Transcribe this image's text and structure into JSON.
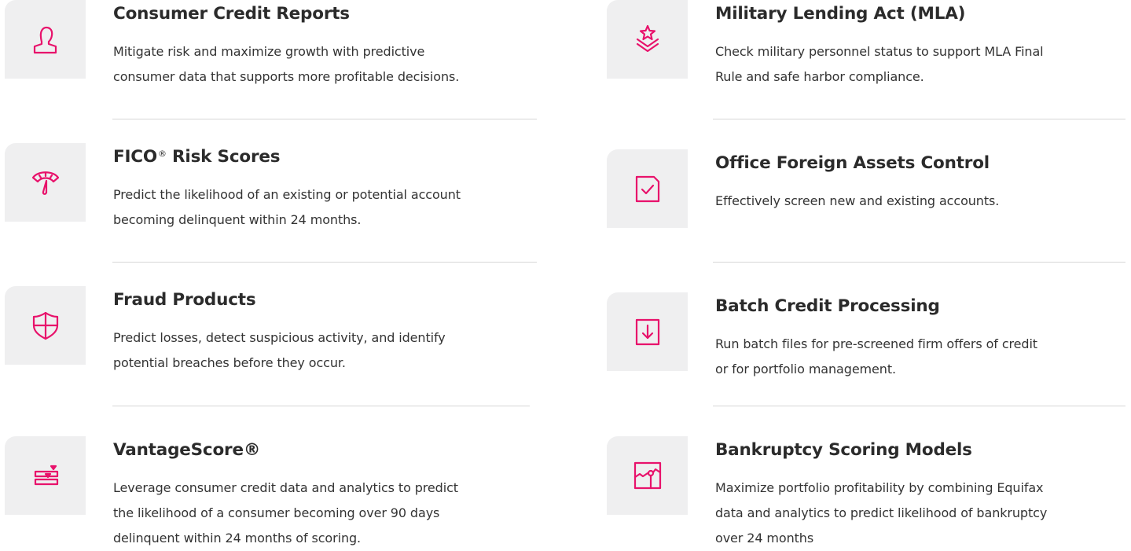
{
  "accent_color": "#e8126b",
  "products": [
    {
      "title": "Consumer Credit Reports",
      "title_sup": "",
      "icon": "person-icon",
      "lines": [
        "Mitigate risk and maximize growth with predictive",
        "consumer data that supports more profitable decisions."
      ]
    },
    {
      "title": "FICO",
      "title_sup": "®",
      "title_rest": " Risk Scores",
      "icon": "gauge-icon",
      "lines": [
        "Predict the likelihood of an existing or potential account",
        "becoming delinquent within 24 months."
      ]
    },
    {
      "title": "Fraud Products",
      "title_sup": "",
      "icon": "shield-icon",
      "lines": [
        "Predict losses, detect suspicious activity, and identify",
        "potential breaches before they occur."
      ]
    },
    {
      "title": "VantageScore®",
      "title_sup": "",
      "icon": "score-bars-icon",
      "lines": [
        "Leverage consumer credit data and analytics to predict",
        "the likelihood of a consumer becoming over 90 days",
        "delinquent within 24 months of scoring."
      ]
    },
    {
      "title": "Military Lending Act (MLA)",
      "title_sup": "",
      "icon": "military-star-icon",
      "lines": [
        "Check military personnel status to support MLA Final",
        "Rule and safe harbor compliance."
      ]
    },
    {
      "title": "Office Foreign Assets Control",
      "title_sup": "",
      "icon": "checkbox-icon",
      "lines": [
        "Effectively screen new and existing accounts."
      ]
    },
    {
      "title": "Batch Credit Processing",
      "title_sup": "",
      "icon": "download-box-icon",
      "lines": [
        "Run batch files for pre-screened firm offers of credit",
        "or for portfolio management."
      ]
    },
    {
      "title": "Bankruptcy Scoring Models",
      "title_sup": "",
      "icon": "chart-frame-icon",
      "lines": [
        "Maximize portfolio profitability by combining Equifax",
        "data and analytics to predict likelihood of bankruptcy",
        "over 24 months"
      ]
    }
  ]
}
